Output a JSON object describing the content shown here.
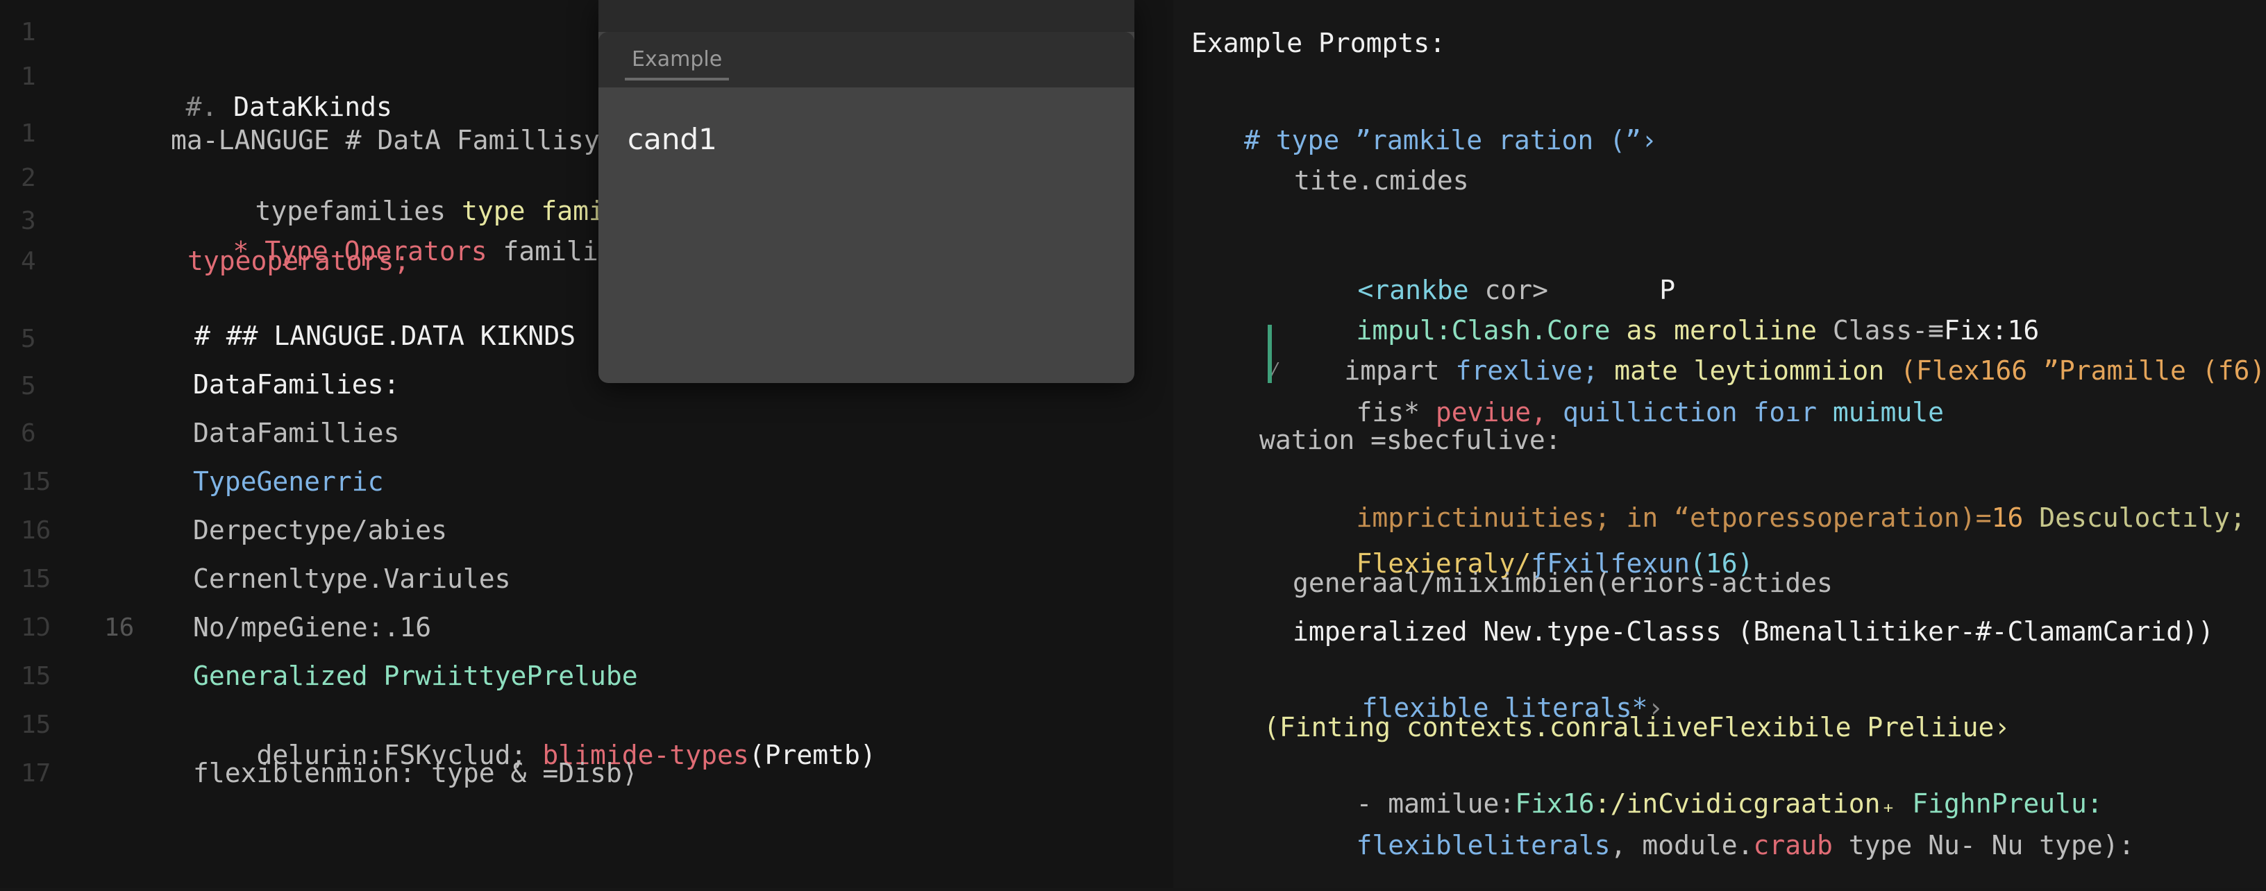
{
  "left_gutter": [
    "1",
    "1",
    "1",
    "2",
    "3",
    "4",
    "5",
    "5",
    "6",
    "15",
    "16",
    "15",
    "1Ͻ",
    "15",
    "15",
    "17"
  ],
  "left_gutter2": [
    "16"
  ],
  "left_lines": [
    [
      "#. ",
      "DataKkinds"
    ],
    [
      "ma-LANGUGE # DatA Famillisy",
      ""
    ],
    [
      "typefamilies ",
      "type familie:"
    ],
    [
      "* ",
      "Type Operators",
      " families"
    ],
    [
      "typeoperators;"
    ],
    [
      "# ## LANGUGE.DATA KIKNDS"
    ],
    [
      "DataFamilies:"
    ],
    [
      "DataFamillies"
    ],
    [
      "TypeGenerric"
    ],
    [
      "Derpectype/abies"
    ],
    [
      "Cernenltype.Variules"
    ],
    [
      "No/mpeGiene:.16"
    ],
    [
      "Generalized PrwiittyePrelube"
    ],
    [
      "delurin:FSKvclud; ",
      "blimide-types",
      "(Premtb)"
    ],
    [
      "flexiblenmion: type & =Disb⟩"
    ]
  ],
  "popup": {
    "tab_label": "Example",
    "value": "cand1"
  },
  "right_title": "Example Prompts:",
  "right_lines": [
    [
      "# type ”ramkile ration (”›"
    ],
    [
      "tite.cmides"
    ],
    [
      "<rankbe ",
      "cor>",
      "       P"
    ],
    [
      "impul:Clash.Core ",
      "as meroliine ",
      "Class-≡",
      "Fix:16"
    ],
    [
      "⁄",
      "impart ",
      "frexlive; ",
      "mate leytiommiion ",
      "(Flex166 ”Pramille (f6)"
    ],
    [
      "fis* ",
      "peviue, ",
      "quilliction foır ",
      "muimule"
    ],
    [
      "wation =sbecfulive:"
    ],
    [
      "imprictinuities; in “etporessoperation)=",
      "16 ",
      "Desculoctıly;"
    ],
    [
      "Flexieraly/",
      "ƒFxilfexun",
      "(16)"
    ],
    [
      "generaal/miiximbien(eriors-actides"
    ],
    [
      "imperalized New.type-Classs (Bmenallitiker-#-ClamamCarid))"
    ],
    [
      "flexible literals*",
      "›"
    ],
    [
      "(Finting contexts.conraliiveFlexibile Preliiue›"
    ],
    [
      "- mamilue:",
      "Fix16",
      ":/inCvidicgraation₊ ",
      "FighnPreulu:"
    ],
    [
      "flexibleliterals",
      ", module.",
      "craub ",
      "type Nu- Nu type):"
    ]
  ]
}
